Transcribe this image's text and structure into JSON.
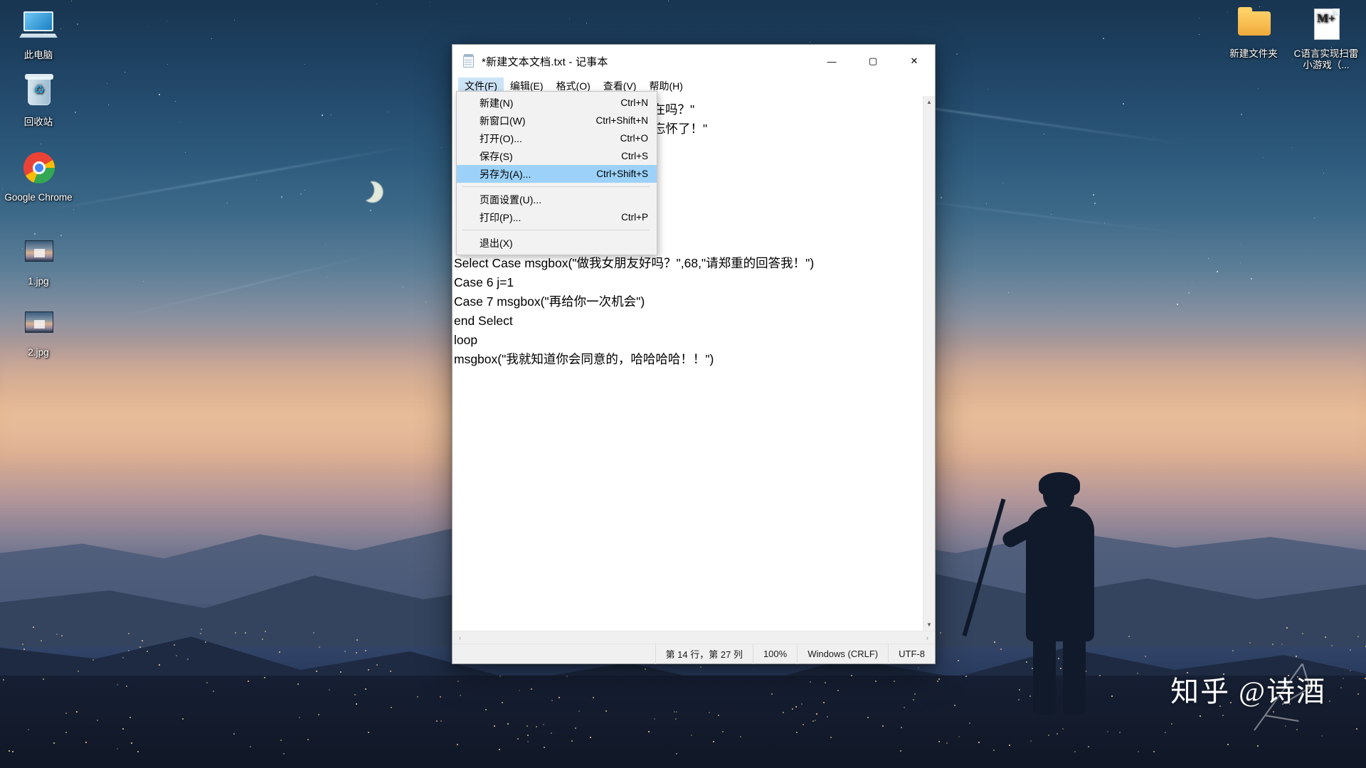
{
  "desktop": {
    "icons_left": [
      {
        "label": "此电脑",
        "icon": "this-pc-icon"
      },
      {
        "label": "回收站",
        "icon": "recycle-bin-icon"
      },
      {
        "label": "Google Chrome",
        "icon": "chrome-icon"
      },
      {
        "label": "1.jpg",
        "icon": "image-file-icon"
      },
      {
        "label": "2.jpg",
        "icon": "image-file-icon"
      }
    ],
    "icons_right": [
      {
        "label": "新建文件夹",
        "icon": "folder-icon"
      },
      {
        "label": "C语言实现扫雷小游戏（...",
        "icon": "document-icon"
      }
    ],
    "watermark": "知乎 @诗酒"
  },
  "window": {
    "title": "*新建文本文档.txt - 记事本",
    "icon": "notepad-icon",
    "controls": {
      "minimize": "—",
      "maximize": "▢",
      "close": "✕"
    },
    "menubar": [
      {
        "label": "文件(F)",
        "active": true
      },
      {
        "label": "编辑(E)",
        "active": false
      },
      {
        "label": "格式(O)",
        "active": false
      },
      {
        "label": "查看(V)",
        "active": false
      },
      {
        "label": "帮助(H)",
        "active": false
      }
    ],
    "file_menu": {
      "items": [
        {
          "label": "新建(N)",
          "accel": "Ctrl+N",
          "selected": false,
          "separator_after": false
        },
        {
          "label": "新窗口(W)",
          "accel": "Ctrl+Shift+N",
          "selected": false,
          "separator_after": false
        },
        {
          "label": "打开(O)...",
          "accel": "Ctrl+O",
          "selected": false,
          "separator_after": false
        },
        {
          "label": "保存(S)",
          "accel": "Ctrl+S",
          "selected": false,
          "separator_after": false
        },
        {
          "label": "另存为(A)...",
          "accel": "Ctrl+Shift+S",
          "selected": true,
          "separator_after": true
        },
        {
          "label": "页面设置(U)...",
          "accel": "",
          "selected": false,
          "separator_after": false
        },
        {
          "label": "打印(P)...",
          "accel": "Ctrl+P",
          "selected": false,
          "separator_after": true
        },
        {
          "label": "退出(X)",
          "accel": "",
          "selected": false,
          "separator_after": false
        }
      ]
    },
    "editor": {
      "content": "                                    ,vbQuestion,\"在吗？\"\n                                    我便对你难以忘怀了！\"\n\n\n\n\n\n\nSelect Case msgbox(\"做我女朋友好吗？\",68,\"请郑重的回答我！\")\nCase 6 j=1\nCase 7 msgbox(\"再给你一次机会\")\nend Select\nloop\nmsgbox(\"我就知道你会同意的，哈哈哈哈！！\")"
    },
    "statusbar": {
      "position": "第 14 行，第 27 列",
      "zoom": "100%",
      "line_ending": "Windows (CRLF)",
      "encoding": "UTF-8"
    },
    "scroll": {
      "up_arrow": "▲",
      "down_arrow": "▼",
      "left_arrow": "‹",
      "right_arrow": "›"
    }
  }
}
